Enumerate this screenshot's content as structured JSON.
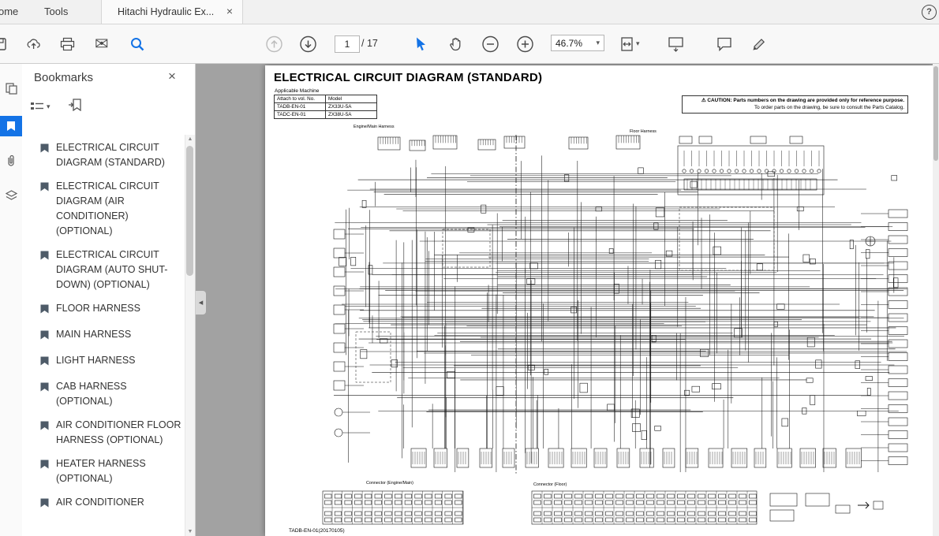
{
  "window": {
    "help_glyph": "?"
  },
  "tabs": {
    "home_label": "ome",
    "tools_label": "Tools",
    "document_label": "Hitachi Hydraulic Ex...",
    "close_glyph": "×"
  },
  "toolbar": {
    "page_current": "1",
    "page_total": "/ 17",
    "zoom_level": "46.7%",
    "caret_glyph": "▾"
  },
  "icons": {
    "envelope_glyph": "✉",
    "scroll_up_glyph": "▲",
    "scroll_down_glyph": "▼",
    "collapse_glyph": "◂"
  },
  "sidebar": {
    "title": "Bookmarks",
    "close_glyph": "×",
    "items": [
      {
        "label": "ELECTRICAL CIRCUIT DIAGRAM (STANDARD)"
      },
      {
        "label": "ELECTRICAL CIRCUIT DIAGRAM  (AIR CONDITIONER) (OPTIONAL)"
      },
      {
        "label": "ELECTRICAL CIRCUIT DIAGRAM (AUTO SHUT-DOWN) (OPTIONAL)"
      },
      {
        "label": "FLOOR HARNESS"
      },
      {
        "label": "MAIN HARNESS"
      },
      {
        "label": "LIGHT HARNESS"
      },
      {
        "label": "CAB HARNESS (OPTIONAL)"
      },
      {
        "label": "AIR CONDITIONER FLOOR HARNESS (OPTIONAL)"
      },
      {
        "label": "HEATER HARNESS (OPTIONAL)"
      },
      {
        "label": "AIR CONDITIONER"
      }
    ]
  },
  "page": {
    "title": "ELECTRICAL CIRCUIT DIAGRAM (STANDARD)",
    "table": {
      "caption": "Applicable Machine",
      "headers": [
        "Attach to vol. No.",
        "Model"
      ],
      "rows": [
        [
          "TADB-EN-01",
          "ZX33U-5A"
        ],
        [
          "TADC-EN-01",
          "ZX38U-5A"
        ]
      ]
    },
    "caution_line1": "⚠ CAUTION: Parts numbers on the drawing are provided only for reference purpose.",
    "caution_line2": "To order parts on the drawing, be sure to consult the Parts Catalog.",
    "label_engine_harness": "Engine/Main Harness",
    "label_floor_harness": "Floor Harness",
    "label_connector_left": "Connector (Engine/Main)",
    "label_connector_right": "Connector (Floor)",
    "footer_code": "TADB-EN-01(20170105)"
  }
}
